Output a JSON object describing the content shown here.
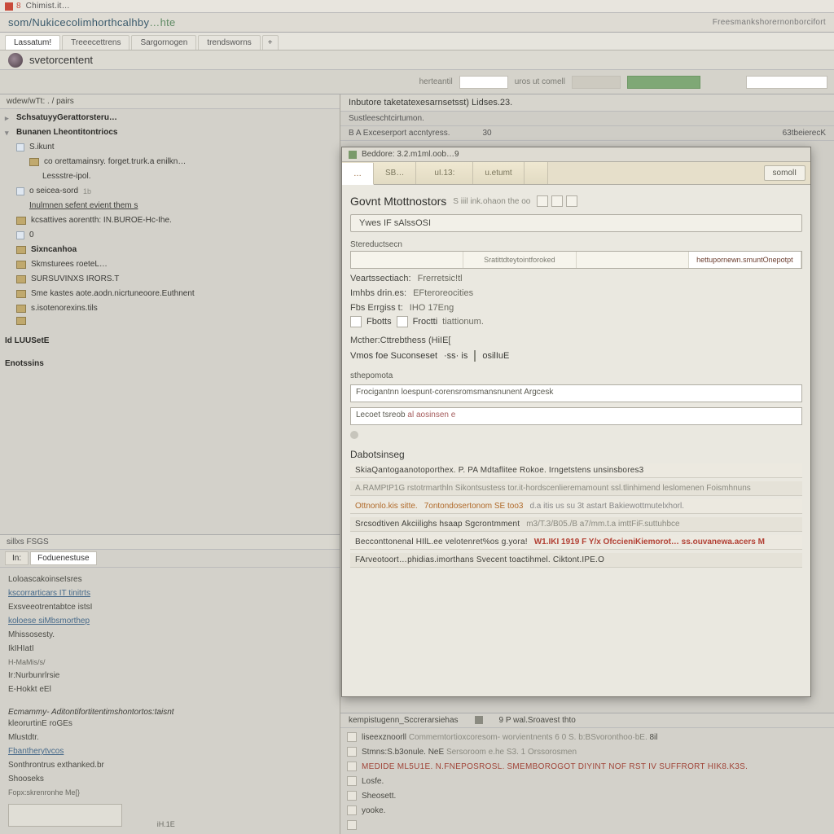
{
  "titlebar": {
    "num": "8",
    "text": "Chimist.it…"
  },
  "header": {
    "breadcrumb_main": "som/Nukicecolimhorthcalhby",
    "breadcrumb_suffix": "…hte",
    "right_text": "Freesmankshorernonborcifort"
  },
  "top_tabs": {
    "items": [
      {
        "label": "Lassatum!",
        "active": true
      },
      {
        "label": "Treeecettrens"
      },
      {
        "label": "Sargornogen"
      },
      {
        "label": "trendsworns"
      }
    ],
    "plus": "+"
  },
  "author": {
    "name": "svetorcentent"
  },
  "toolbar": {
    "field1_label": "herteantil",
    "field2_label": "uros ut comell"
  },
  "tree": {
    "section1": "SchsatuyyGerattorsteru…",
    "section2": "Bunanen Lheontitontriocs",
    "n1": "S.ikunt",
    "n1a": "co orettamainsry. forget.trurk.a enilkn…",
    "n1b": "Lessstre-ipol.",
    "n2": "o seicea-sord",
    "n2_hint": "1b",
    "n3": "Inulmnen sefent evient them s",
    "n4": "kcsattives aorentth: IN.BUROE-Hc-Ihe.",
    "n5": "0",
    "n6": "Sixncanhoa",
    "n7": "Skmsturees roeteL…",
    "n8": "SURSUVINXS IRORS.T",
    "n9": "Sme kastes aote.aodn.nicrtuneoore.Euthnent",
    "n10": "s.isotenorexins.tils",
    "n11": "",
    "sec3": "Id LUUSetE",
    "sec4": "Enotssins"
  },
  "bl": {
    "head": "sillxs FSGS",
    "tabs": [
      "In:",
      "Foduenestuse"
    ],
    "rows": [
      "LoloascakoinseIsres",
      "kscorrarticars IT tinitrts",
      "Exsveeotrentabtce istsI",
      "koloese siMbsmorthep",
      "Mhissosesty.",
      "IkIHIatI",
      "H-MaMis/s/",
      "Ir:Nurbunrlrsie",
      "E-Hokkt eEl"
    ],
    "row_date": "",
    "sec_head": "Ecmammy- Aditontifortitentimshontortos:taisnt",
    "sec_rows": [
      "kleorurtinE roGEs",
      "Mlustdtr.",
      "Fbantherytvcos",
      "Sonthrontrus exthanked.br",
      "Shooseks"
    ],
    "sec_sub": "Fopx:skrenronhe Me[}",
    "box_label": "iH.1E"
  },
  "right_header": {
    "title": "Inbutore taketatexesarnsetsst) Lidses.23.",
    "sub1": "Sustleeschtcirtumon.",
    "sub2_l": "B A Exceserport accntyress.",
    "sub2_r": "63tbeierecK"
  },
  "dialog": {
    "title": "Beddore: 3.2.m1ml.oob…9",
    "tabs": [
      {
        "label": "…",
        "active": true
      },
      {
        "label": "SB…"
      },
      {
        "label": "uI.13:"
      },
      {
        "label": "u.etumt"
      },
      {
        "label": ""
      }
    ],
    "tab_btn": "somolI",
    "h_main": "Govnt Mtottnostors",
    "h_sub": "S iiil ink.ohaon the  oo",
    "chip": "Ywes IF sAlssOSI",
    "sec_label": "Stereductsecn",
    "strip_tabs": [
      "",
      "Sratittdteytointforoked",
      "",
      "hettupornewn.smuntOnepotpt"
    ],
    "kv1_k": "Veartssectiach:",
    "kv1_v": "Frerretsic!tl",
    "kv2_k": "Imhbs drin.es:",
    "kv2_v": "EFteroreocities",
    "kv3_k": "Fbs Errgiss t:",
    "kv3_v": "IHO 17Eng",
    "kv4_n1": "Fbotts",
    "kv4_n2": "Froctti",
    "kv4_v": "tiattionum.",
    "kv5_k": "Mcther:Cttrebthess (HiIE[",
    "scope_label": "Vmos foe Suconseset",
    "scope_sub": "osilIuE",
    "scope_input_label": "sthepomota",
    "input1": "Frocigantnn loespunt-corensromsmansnunent Argcesk",
    "input2_a": "Lecoet tsreob",
    "input2_b": "al aosinsen e",
    "results_head": "Dabotsinseg",
    "results": [
      {
        "t1": "SkiaQantogaanotoporthex. P. PA  Mdtaflitee Rokoe. Irngetstens unsinsbores3",
        "t2": "",
        "cls": ""
      },
      {
        "t1": "A.RAMPtP1G  rstotrmarthln Sikontsustess tor.it-hordscenlieremamount ssl.tlinhimend leslomenen Foismhnuns",
        "t2": "",
        "cls": "alt"
      },
      {
        "t1": "Ottnonlo.kis sitte.",
        "t2": "7ontondosertonom SE too3",
        "r": "d.a itis us su  3t  astart Bakiewottmutelxhorl.",
        "cls": "",
        "amber": true
      },
      {
        "t1": "Srcsodtiven Akciilighs hsaap Sgcrontmment",
        "t2": "  m3/T.3/B05./B  a7/mm.t.a   imttFiF.suttuhbce",
        "cls": "alt"
      },
      {
        "t1": "Becconttonenal HIlL.ee velotenret%os     g.yora!",
        "t2": "W1.IKI 1919 F  Y/x  OfccieniKiemorot…   ss.ouvanewa.acers M",
        "cls": "",
        "red": true
      },
      {
        "t1": "FArveotoort…phidias.imorthans Svecent toactihmel.  Ciktont.IPE.O",
        "t2": "",
        "cls": "alt"
      }
    ]
  },
  "console": {
    "head_l": "kempistugenn_Sccrerarsiehas",
    "head_m": "9 P wal.Sroavest thto",
    "rows": [
      {
        "a": "liseexznoorll",
        "b": "Commemtortioxcoresom-  worvientnents 6 0 S.",
        "c": "b:BSvoronthoo·bE.",
        "d": "8il"
      },
      {
        "a": "Stmns:S.b3onule. NeE",
        "b": "Sersoroom e.he S3.",
        "c": "1 Orssorosmen",
        "d": ""
      },
      {
        "a": "MEDIDE ML5U1E.  N.FNEPOSROSL.",
        "b": "SMEMBOROGOT DIYINT NOF RST iV suffrort  HIk8.K3S.",
        "c": "",
        "red": true
      },
      {
        "a": "Losfe.",
        "b": "",
        "c": ""
      },
      {
        "a": "Sheosett.",
        "b": "",
        "c": ""
      },
      {
        "a": "yooke.",
        "b": "",
        "c": ""
      },
      {
        "a": "",
        "b": "",
        "c": ""
      }
    ]
  }
}
